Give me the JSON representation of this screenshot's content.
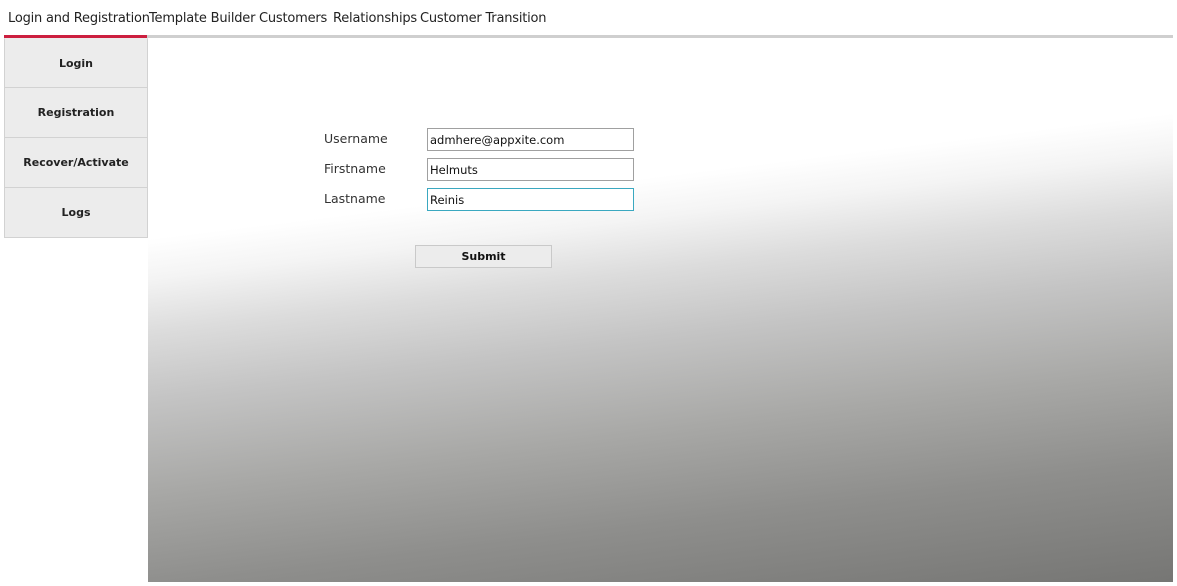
{
  "tabs": [
    {
      "label": "Login and Registration",
      "active": true
    },
    {
      "label": "Template Builder",
      "active": false
    },
    {
      "label": "Customers",
      "active": false
    },
    {
      "label": "Relationships",
      "active": false
    },
    {
      "label": "Customer Transition",
      "active": false
    }
  ],
  "sidebar": {
    "items": [
      {
        "label": "Login"
      },
      {
        "label": "Registration"
      },
      {
        "label": "Recover/Activate"
      },
      {
        "label": "Logs"
      }
    ]
  },
  "form": {
    "username": {
      "label": "Username",
      "value": "admhere@appxite.com"
    },
    "firstname": {
      "label": "Firstname",
      "value": "Helmuts"
    },
    "lastname": {
      "label": "Lastname",
      "value": "Reinis"
    },
    "submit_label": "Submit"
  },
  "colors": {
    "accent": "#cc1f3f",
    "focus_border": "#3aa8c0",
    "button_bg": "#ececec"
  }
}
